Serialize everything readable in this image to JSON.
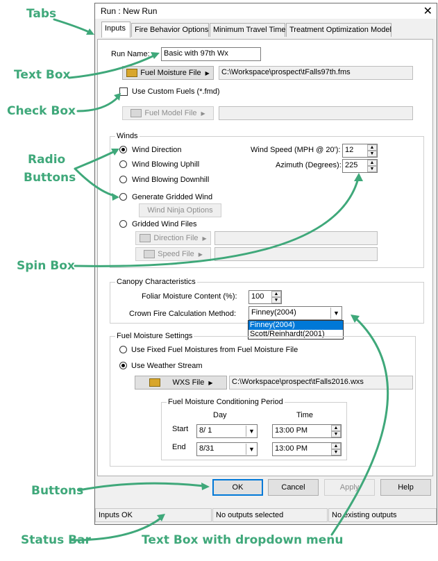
{
  "window": {
    "title": "Run : New Run",
    "close_glyph": "✕"
  },
  "tabs": [
    "Inputs",
    "Fire Behavior Options",
    "Minimum Travel Time",
    "Treatment Optimization Model"
  ],
  "inputs": {
    "run_name_label": "Run Name:",
    "run_name_value": "Basic with 97th Wx",
    "fuel_moisture_button": "Fuel Moisture File",
    "fuel_moisture_path": "C:\\Workspace\\prospect\\tFalls97th.fms",
    "custom_fuels_label": "Use Custom Fuels (*.fmd)",
    "custom_fuels_checked": false,
    "fuel_model_button": "Fuel Model File",
    "fuel_model_path": ""
  },
  "winds": {
    "legend": "Winds",
    "options": [
      "Wind Direction",
      "Wind Blowing Uphill",
      "Wind Blowing Downhill",
      "Generate Gridded Wind",
      "Gridded Wind Files"
    ],
    "selected_index": 0,
    "ninja_button": "Wind Ninja Options",
    "direction_file_button": "Direction File",
    "speed_file_button": "Speed File",
    "wind_speed_label": "Wind Speed (MPH @ 20'):",
    "wind_speed_value": "12",
    "azimuth_label": "Azimuth (Degrees):",
    "azimuth_value": "225"
  },
  "canopy": {
    "legend": "Canopy Characteristics",
    "foliar_label": "Foliar Moisture Content (%):",
    "foliar_value": "100",
    "crown_label": "Crown Fire Calculation Method:",
    "crown_value": "Finney(2004)",
    "crown_options": [
      "Finney(2004)",
      "Scott/Reinhardt(2001)"
    ]
  },
  "fuel_moisture_settings": {
    "legend": "Fuel Moisture Settings",
    "option_fixed": "Use Fixed Fuel Moistures from Fuel Moisture File",
    "option_weather": "Use Weather Stream",
    "selected_index": 1,
    "wxs_button": "WXS File",
    "wxs_path": "C:\\Workspace\\prospect\\tFalls2016.wxs",
    "conditioning": {
      "legend": "Fuel Moisture Conditioning Period",
      "day_header": "Day",
      "time_header": "Time",
      "start_label": "Start",
      "start_day": "8/ 1",
      "start_time": "13:00 PM",
      "end_label": "End",
      "end_day": "8/31",
      "end_time": "13:00 PM"
    }
  },
  "buttons": {
    "ok": "OK",
    "cancel": "Cancel",
    "apply": "Apply",
    "help": "Help"
  },
  "status_bar": [
    "Inputs OK",
    "No outputs selected",
    "No existing outputs"
  ],
  "annotations": {
    "tabs": "Tabs",
    "text_box": "Text Box",
    "check_box": "Check Box",
    "radio_buttons_1": "Radio",
    "radio_buttons_2": "Buttons",
    "spin_box": "Spin Box",
    "buttons": "Buttons",
    "status_bar": "Status Bar",
    "text_box_dropdown": "Text Box with dropdown menu"
  },
  "colors": {
    "annotation": "#3fa87a",
    "selection": "#0078d7"
  }
}
